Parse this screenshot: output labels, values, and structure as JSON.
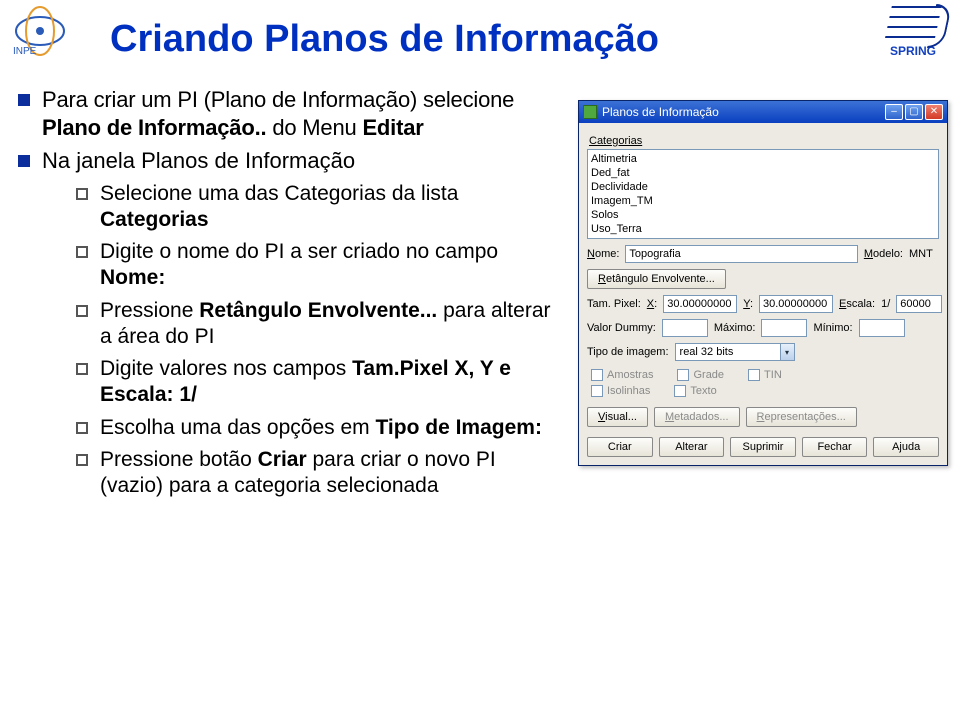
{
  "logos": {
    "inpe_label": "INPE",
    "spring_label": "SPRING"
  },
  "title": "Criando Planos de Informação",
  "bullets": [
    {
      "text_parts": [
        "Para criar um PI (Plano de Informação) selecione ",
        "Plano de Informação..",
        " do Menu ",
        "Editar"
      ]
    },
    {
      "text_parts": [
        "Na janela Planos de Informação"
      ],
      "subs": [
        {
          "parts": [
            "Selecione uma das Categorias da lista ",
            "Categorias"
          ],
          "bold_idx": [
            1
          ]
        },
        {
          "parts": [
            "Digite o nome do PI a ser criado no campo ",
            "Nome:"
          ],
          "bold_idx": [
            1
          ]
        },
        {
          "parts": [
            "Pressione ",
            "Retângulo Envolvente...",
            " para alterar a área do PI"
          ],
          "bold_idx": [
            1
          ]
        },
        {
          "parts": [
            "Digite valores nos campos ",
            "Tam.Pixel X, Y e Escala: 1/"
          ],
          "bold_idx": [
            1
          ]
        },
        {
          "parts": [
            "Escolha uma das opções em ",
            "Tipo de Imagem:"
          ],
          "bold_idx": [
            1
          ]
        },
        {
          "parts": [
            "Pressione botão ",
            "Criar",
            " para criar o novo PI (vazio) para a categoria selecionada"
          ],
          "bold_idx": [
            1
          ]
        }
      ]
    }
  ],
  "dialog": {
    "window_title": "Planos de Informação",
    "labels": {
      "categorias": "Categorias",
      "nome": "Nome:",
      "modelo": "Modelo:",
      "tam_pixel": "Tam. Pixel:",
      "x": "X:",
      "y": "Y:",
      "escala": "Escala:",
      "escala_prefix": "1/",
      "valor_dummy": "Valor Dummy:",
      "maximo": "Máximo:",
      "minimo": "Mínimo:",
      "tipo_imagem": "Tipo de imagem:"
    },
    "categorias_list": [
      "Altimetria",
      "Ded_fat",
      "Declividade",
      "Imagem_TM",
      "Solos",
      "Uso_Terra"
    ],
    "fields": {
      "nome_value": "Topografia",
      "modelo_value": "MNT",
      "x_value": "30.00000000",
      "y_value": "30.00000000",
      "escala_value": "60000",
      "valor_dummy_value": "",
      "maximo_value": "",
      "minimo_value": "",
      "tipo_imagem_value": "real 32 bits"
    },
    "buttons": {
      "retangulo": "Retângulo Envolvente...",
      "visual": "Visual...",
      "metadados": "Metadados...",
      "representacoes": "Representações...",
      "criar": "Criar",
      "alterar": "Alterar",
      "suprimir": "Suprimir",
      "fechar": "Fechar",
      "ajuda": "Ajuda"
    },
    "checks": {
      "amostras": "Amostras",
      "grade": "Grade",
      "tin": "TIN",
      "isolinhas": "Isolinhas",
      "texto": "Texto"
    }
  }
}
